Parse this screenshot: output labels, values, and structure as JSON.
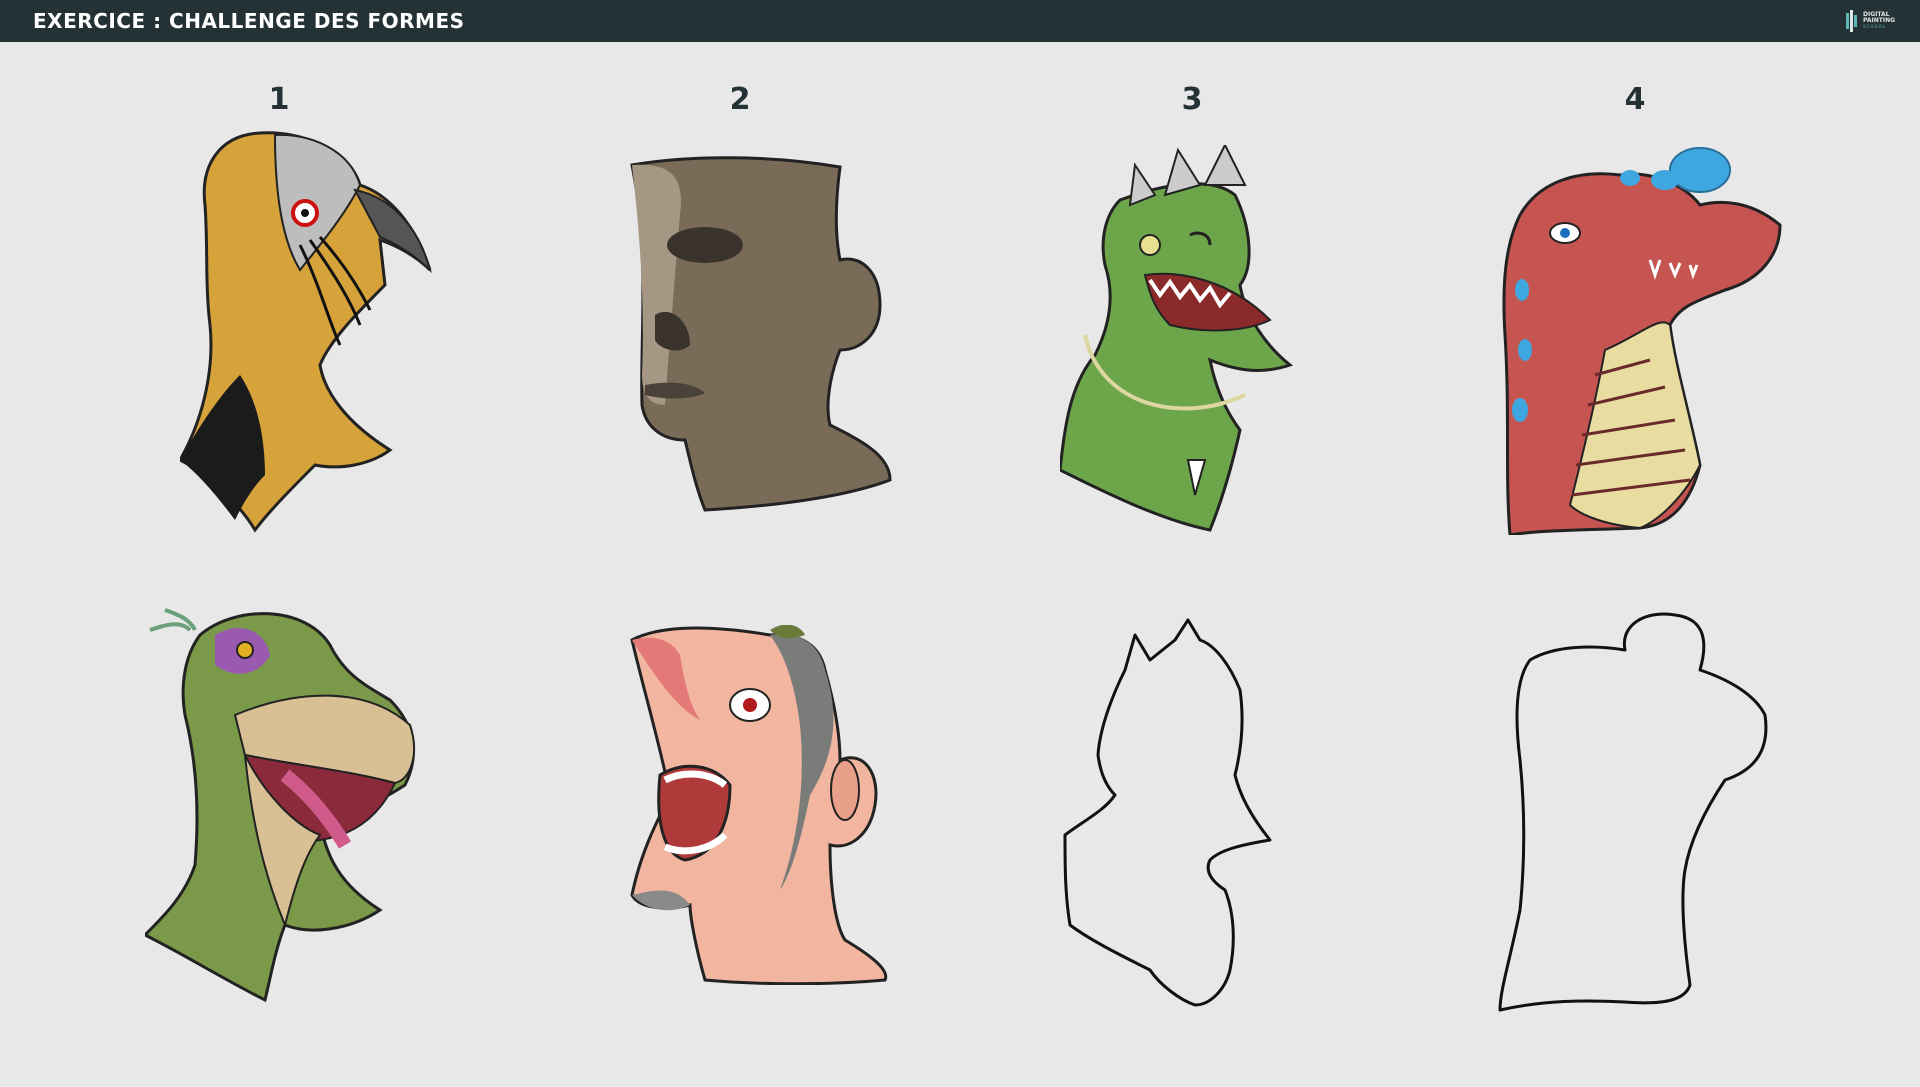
{
  "header": {
    "title": "EXERCICE : CHALLENGE DES FORMES",
    "logo_line1": "DIGITAL",
    "logo_line2": "PAINTING",
    "logo_line3": "SCHOOL"
  },
  "columns": [
    {
      "number": "1"
    },
    {
      "number": "2"
    },
    {
      "number": "3"
    },
    {
      "number": "4"
    }
  ],
  "colors": {
    "background": "#e8e8e8",
    "topbar": "#243236",
    "accent": "#5fb8b8"
  }
}
